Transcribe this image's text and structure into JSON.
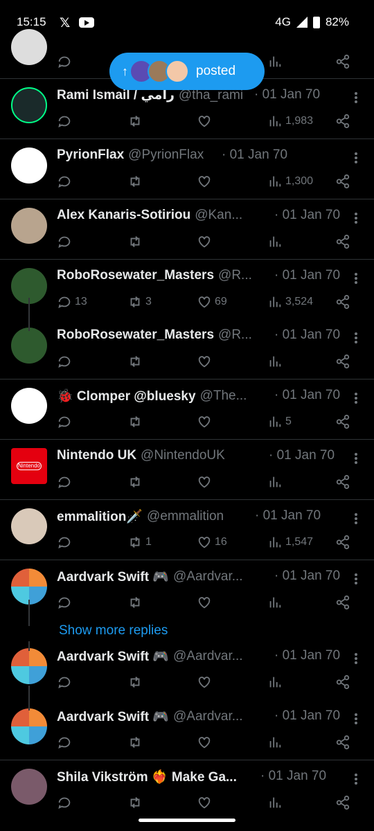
{
  "status_bar": {
    "time": "15:15",
    "x_icon": "𝕏",
    "network": "4G",
    "battery": "82%"
  },
  "new_posts_pill": {
    "label": "posted"
  },
  "show_more": "Show more replies",
  "tweets": [
    {
      "name": "Rami Ismail / رامي",
      "handle": "@tha_rami",
      "date": "· 01 Jan 70",
      "views": "1,983",
      "replies": "",
      "retweets": "",
      "likes": ""
    },
    {
      "name": "PyrionFlax",
      "handle": "@PyrionFlax",
      "date": "· 01 Jan 70",
      "views": "1,300",
      "replies": "",
      "retweets": "",
      "likes": ""
    },
    {
      "name": "Alex Kanaris-Sotiriou",
      "handle": "@Kan...",
      "date": "· 01 Jan 70",
      "views": "",
      "replies": "",
      "retweets": "",
      "likes": ""
    },
    {
      "name": "RoboRosewater_Masters",
      "handle": "@R...",
      "date": "· 01 Jan 70",
      "views": "3,524",
      "replies": "13",
      "retweets": "3",
      "likes": "69"
    },
    {
      "name": "RoboRosewater_Masters",
      "handle": "@R...",
      "date": "· 01 Jan 70",
      "views": "",
      "replies": "",
      "retweets": "",
      "likes": ""
    },
    {
      "name": "🐞 Clomper @bluesky",
      "handle": "@The...",
      "date": "· 01 Jan 70",
      "views": "5",
      "replies": "",
      "retweets": "",
      "likes": ""
    },
    {
      "name": "Nintendo UK",
      "handle": "@NintendoUK",
      "date": "· 01 Jan 70",
      "views": "",
      "replies": "",
      "retweets": "",
      "likes": "",
      "avatar_text": "Nintendo"
    },
    {
      "name": "emmalition🗡️",
      "handle": "@emmalition",
      "date": "· 01 Jan 70",
      "views": "1,547",
      "replies": "",
      "retweets": "1",
      "likes": "16"
    },
    {
      "name": "Aardvark Swift 🎮",
      "handle": "@Aardvar...",
      "date": "· 01 Jan 70",
      "views": "",
      "replies": "",
      "retweets": "",
      "likes": ""
    },
    {
      "name": "Aardvark Swift 🎮",
      "handle": "@Aardvar...",
      "date": "· 01 Jan 70",
      "views": "",
      "replies": "",
      "retweets": "",
      "likes": ""
    },
    {
      "name": "Aardvark Swift 🎮",
      "handle": "@Aardvar...",
      "date": "· 01 Jan 70",
      "views": "",
      "replies": "",
      "retweets": "",
      "likes": ""
    },
    {
      "name": "Shila Vikström ❤️‍🔥 Make Ga...",
      "handle": "",
      "date": "· 01 Jan 70",
      "views": "",
      "replies": "",
      "retweets": "",
      "likes": ""
    }
  ]
}
